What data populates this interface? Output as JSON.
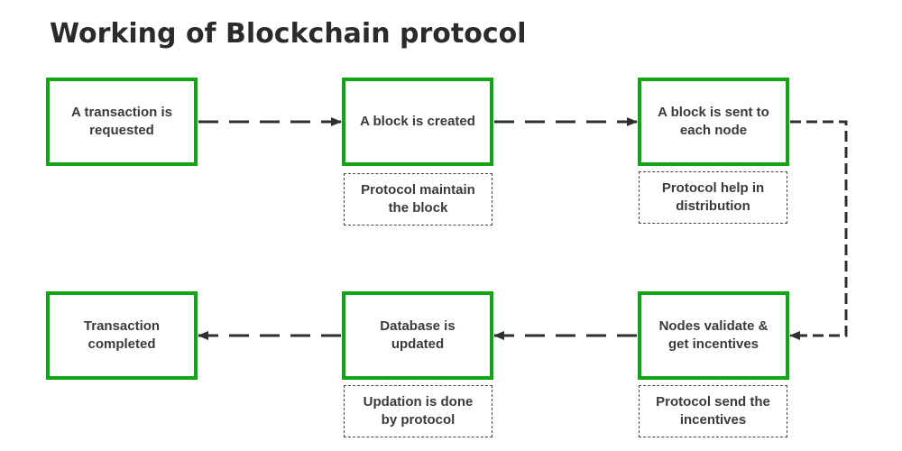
{
  "title": "Working of Blockchain protocol",
  "colors": {
    "box_border": "#11a511",
    "connector": "#2f2f2f",
    "text": "#3a3a3a"
  },
  "steps": [
    {
      "label": "A transaction is requested"
    },
    {
      "label": "A block is created",
      "note": "Protocol maintain the block"
    },
    {
      "label": "A block is sent to each node",
      "note": "Protocol help in distribution"
    },
    {
      "label": "Nodes validate & get incentives",
      "note": "Protocol send the incentives"
    },
    {
      "label": "Database is updated",
      "note": "Updation is done by protocol"
    },
    {
      "label": "Transaction completed"
    }
  ],
  "flow": [
    {
      "from": 0,
      "to": 1,
      "style": "dashed-arrow"
    },
    {
      "from": 1,
      "to": 2,
      "style": "dashed-arrow"
    },
    {
      "from": 2,
      "to": 3,
      "style": "dashed-arrow"
    },
    {
      "from": 3,
      "to": 4,
      "style": "dashed-arrow"
    },
    {
      "from": 4,
      "to": 5,
      "style": "dashed-arrow"
    }
  ]
}
